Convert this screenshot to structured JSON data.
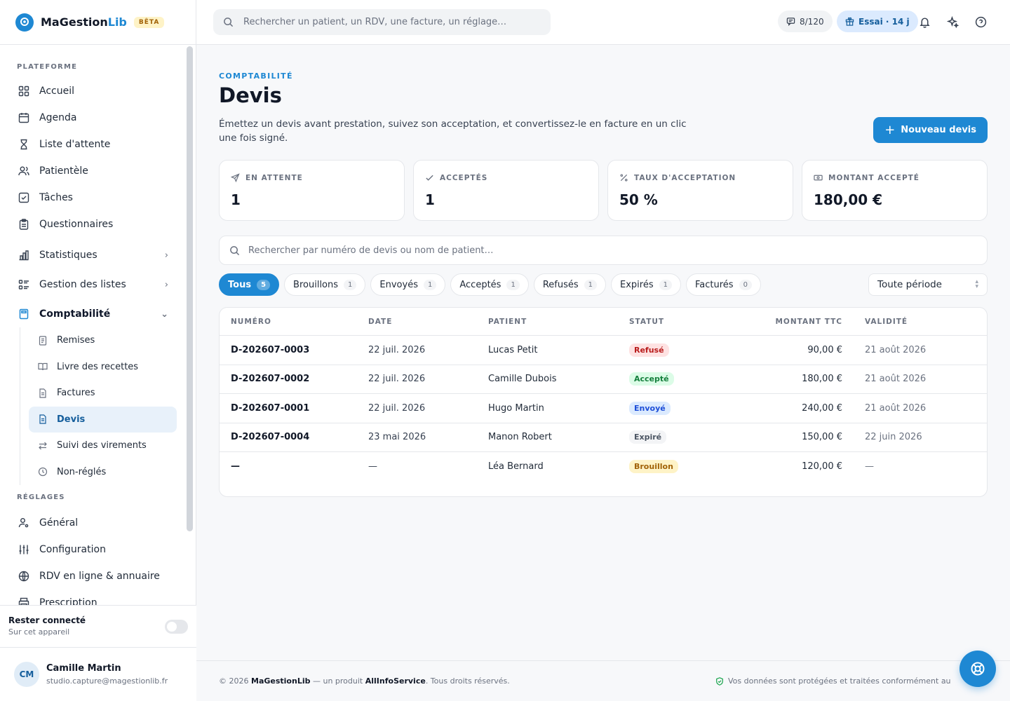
{
  "brand": {
    "name_main": "MaGestion",
    "name_accent": "Lib",
    "badge": "BÊTA"
  },
  "sidebar": {
    "section_platform": "PLATEFORME",
    "items": [
      {
        "label": "Accueil",
        "icon": "grid-icon"
      },
      {
        "label": "Agenda",
        "icon": "calendar-icon"
      },
      {
        "label": "Liste d'attente",
        "icon": "hourglass-icon"
      },
      {
        "label": "Patientèle",
        "icon": "users-icon"
      },
      {
        "label": "Tâches",
        "icon": "checkbox-icon"
      },
      {
        "label": "Questionnaires",
        "icon": "clipboard-icon"
      }
    ],
    "statistiques": "Statistiques",
    "gestion_listes": "Gestion des listes",
    "comptabilite": "Comptabilité",
    "compta_items": [
      {
        "label": "Remises",
        "icon": "receipt-icon"
      },
      {
        "label": "Livre des recettes",
        "icon": "book-icon"
      },
      {
        "label": "Factures",
        "icon": "file-icon"
      },
      {
        "label": "Devis",
        "icon": "file-icon"
      },
      {
        "label": "Suivi des virements",
        "icon": "transfer-icon"
      },
      {
        "label": "Non-réglés",
        "icon": "clock-icon"
      }
    ],
    "section_settings": "RÉGLAGES",
    "settings_items": [
      {
        "label": "Général",
        "icon": "user-cog-icon"
      },
      {
        "label": "Configuration",
        "icon": "sliders-icon"
      },
      {
        "label": "RDV en ligne & annuaire",
        "icon": "globe-icon"
      },
      {
        "label": "Prescription",
        "icon": "printer-icon"
      }
    ],
    "stay_connected": {
      "title": "Rester connecté",
      "subtitle": "Sur cet appareil"
    },
    "user": {
      "initials": "CM",
      "name": "Camille Martin",
      "email": "studio.capture@magestionlib.fr"
    }
  },
  "topbar": {
    "search_placeholder": "Rechercher un patient, un RDV, une facture, un réglage…",
    "sms_count": "8/120",
    "trial": "Essai · 14 j"
  },
  "page": {
    "eyebrow": "COMPTABILITÉ",
    "title": "Devis",
    "description": "Émettez un devis avant prestation, suivez son acceptation, et convertissez-le en facture en un clic une fois signé.",
    "new_button": "Nouveau devis"
  },
  "stats": [
    {
      "label": "EN ATTENTE",
      "value": "1",
      "icon": "send-icon"
    },
    {
      "label": "ACCEPTÉS",
      "value": "1",
      "icon": "check-icon"
    },
    {
      "label": "TAUX D'ACCEPTATION",
      "value": "50 %",
      "icon": "percent-icon"
    },
    {
      "label": "MONTANT ACCEPTÉ",
      "value": "180,00 €",
      "icon": "banknote-icon"
    }
  ],
  "list_search_placeholder": "Rechercher par numéro de devis ou nom de patient…",
  "filters": [
    {
      "label": "Tous",
      "count": "5",
      "active": true
    },
    {
      "label": "Brouillons",
      "count": "1"
    },
    {
      "label": "Envoyés",
      "count": "1"
    },
    {
      "label": "Acceptés",
      "count": "1"
    },
    {
      "label": "Refusés",
      "count": "1"
    },
    {
      "label": "Expirés",
      "count": "1"
    },
    {
      "label": "Facturés",
      "count": "0"
    }
  ],
  "period": "Toute période",
  "table": {
    "headers": {
      "numero": "NUMÉRO",
      "date": "DATE",
      "patient": "PATIENT",
      "statut": "STATUT",
      "montant": "MONTANT TTC",
      "validite": "VALIDITÉ"
    },
    "rows": [
      {
        "numero": "D-202607-0003",
        "date": "22 juil. 2026",
        "patient": "Lucas Petit",
        "statut": "Refusé",
        "montant": "90,00 €",
        "validite": "21 août 2026"
      },
      {
        "numero": "D-202607-0002",
        "date": "22 juil. 2026",
        "patient": "Camille Dubois",
        "statut": "Accepté",
        "montant": "180,00 €",
        "validite": "21 août 2026"
      },
      {
        "numero": "D-202607-0001",
        "date": "22 juil. 2026",
        "patient": "Hugo Martin",
        "statut": "Envoyé",
        "montant": "240,00 €",
        "validite": "21 août 2026"
      },
      {
        "numero": "D-202607-0004",
        "date": "23 mai 2026",
        "patient": "Manon Robert",
        "statut": "Expiré",
        "montant": "150,00 €",
        "validite": "22 juin 2026"
      },
      {
        "numero": "—",
        "date": "—",
        "patient": "Léa Bernard",
        "statut": "Brouillon",
        "montant": "120,00 €",
        "validite": "—"
      }
    ]
  },
  "footer": {
    "year": "© 2026",
    "brand": "MaGestionLib",
    "mid": "— un produit",
    "company": "AllInfoService",
    "rights": ". Tous droits réservés.",
    "privacy": "Vos données sont protégées et traitées conformément au"
  },
  "colors": {
    "accent": "#1e88d3",
    "active_bg": "#e8f1fa"
  }
}
